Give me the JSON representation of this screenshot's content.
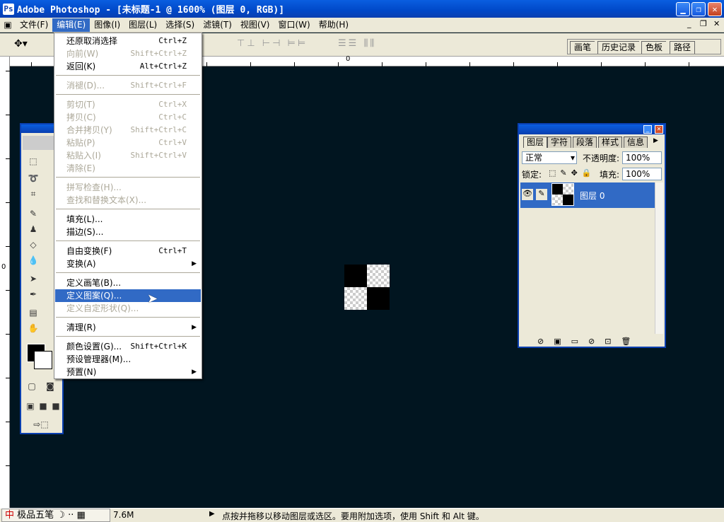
{
  "window": {
    "title": "Adobe Photoshop - [未标题-1 @ 1600% (图层 0, RGB)]"
  },
  "menubar": [
    "文件(F)",
    "编辑(E)",
    "图像(I)",
    "图层(L)",
    "选择(S)",
    "滤镜(T)",
    "视图(V)",
    "窗口(W)",
    "帮助(H)"
  ],
  "palette_well": [
    "画笔",
    "历史记录",
    "色板",
    "路径"
  ],
  "ruler": {
    "top_zero": "0",
    "left_zero": "0"
  },
  "edit_menu": {
    "items": [
      {
        "label": "还原取消选择",
        "shortcut": "Ctrl+Z",
        "disabled": false
      },
      {
        "label": "向前(W)",
        "shortcut": "Shift+Ctrl+Z",
        "disabled": true
      },
      {
        "label": "返回(K)",
        "shortcut": "Alt+Ctrl+Z",
        "disabled": false
      },
      {
        "label": "消褪(D)...",
        "shortcut": "Shift+Ctrl+F",
        "disabled": true
      },
      {
        "label": "剪切(T)",
        "shortcut": "Ctrl+X",
        "disabled": true
      },
      {
        "label": "拷贝(C)",
        "shortcut": "Ctrl+C",
        "disabled": true
      },
      {
        "label": "合并拷贝(Y)",
        "shortcut": "Shift+Ctrl+C",
        "disabled": true
      },
      {
        "label": "粘贴(P)",
        "shortcut": "Ctrl+V",
        "disabled": true
      },
      {
        "label": "粘贴入(I)",
        "shortcut": "Shift+Ctrl+V",
        "disabled": true
      },
      {
        "label": "清除(E)",
        "shortcut": "",
        "disabled": true
      },
      {
        "label": "拼写检查(H)...",
        "shortcut": "",
        "disabled": true
      },
      {
        "label": "查找和替换文本(X)...",
        "shortcut": "",
        "disabled": true
      },
      {
        "label": "填充(L)...",
        "shortcut": "",
        "disabled": false
      },
      {
        "label": "描边(S)...",
        "shortcut": "",
        "disabled": false
      },
      {
        "label": "自由变换(F)",
        "shortcut": "Ctrl+T",
        "disabled": false
      },
      {
        "label": "变换(A)",
        "shortcut": "",
        "disabled": false,
        "submenu": true
      },
      {
        "label": "定义画笔(B)...",
        "shortcut": "",
        "disabled": false
      },
      {
        "label": "定义图案(Q)...",
        "shortcut": "",
        "disabled": false,
        "highlighted": true
      },
      {
        "label": "定义自定形状(Q)...",
        "shortcut": "",
        "disabled": true
      },
      {
        "label": "清理(R)",
        "shortcut": "",
        "disabled": false,
        "submenu": true
      },
      {
        "label": "颜色设置(G)...",
        "shortcut": "Shift+Ctrl+K",
        "disabled": false
      },
      {
        "label": "预设管理器(M)...",
        "shortcut": "",
        "disabled": false
      },
      {
        "label": "预置(N)",
        "shortcut": "",
        "disabled": false,
        "submenu": true
      }
    ]
  },
  "layers_palette": {
    "tabs": [
      "图层",
      "字符",
      "段落",
      "样式",
      "信息"
    ],
    "blend_mode": "正常",
    "opacity_label": "不透明度:",
    "opacity_value": "100%",
    "lock_label": "锁定:",
    "fill_label": "填充:",
    "fill_value": "100%",
    "layer_name": "图层 0"
  },
  "status": {
    "ime": "极品五笔",
    "doc_size": "7.6M",
    "hint": "点按并拖移以移动图层或选区。要用附加选项，使用 Shift 和 Alt 键。"
  },
  "colors": {
    "titlebar": "#0a5ee0",
    "canvas_bg": "#011520",
    "highlight": "#316ac5"
  }
}
